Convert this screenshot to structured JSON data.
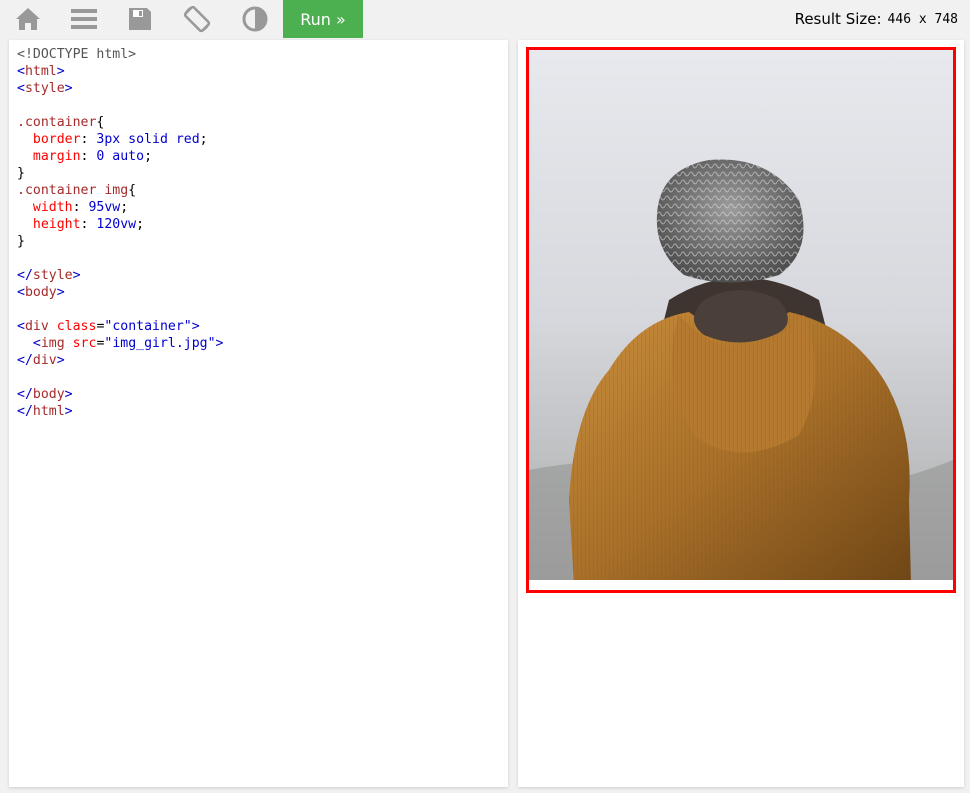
{
  "toolbar": {
    "icons": [
      "home-icon",
      "menu-icon",
      "save-icon",
      "rotate-icon",
      "contrast-icon"
    ],
    "run_label": "Run »",
    "result_size_label": "Result Size:",
    "result_size_value": "446 x 748"
  },
  "editor": {
    "lines": [
      "<!DOCTYPE html>",
      "<html>",
      "<style>",
      "",
      ".container{",
      "  border: 3px solid red;",
      "  margin: 0 auto;",
      "}",
      ".container img{",
      "  width: 95vw;",
      "  height: 120vw;",
      "}",
      "",
      "</style>",
      "<body>",
      "",
      "<div class=\"container\">",
      "  <img src=\"img_girl.jpg\">",
      "</div>",
      "",
      "</body>",
      "</html>"
    ]
  },
  "result": {
    "border_color": "#ff0000",
    "image_name": "img_girl.jpg"
  },
  "colors": {
    "run_button": "#4caf50",
    "toolbar_bg": "#f1f1f1",
    "icon_gray": "#999999"
  }
}
